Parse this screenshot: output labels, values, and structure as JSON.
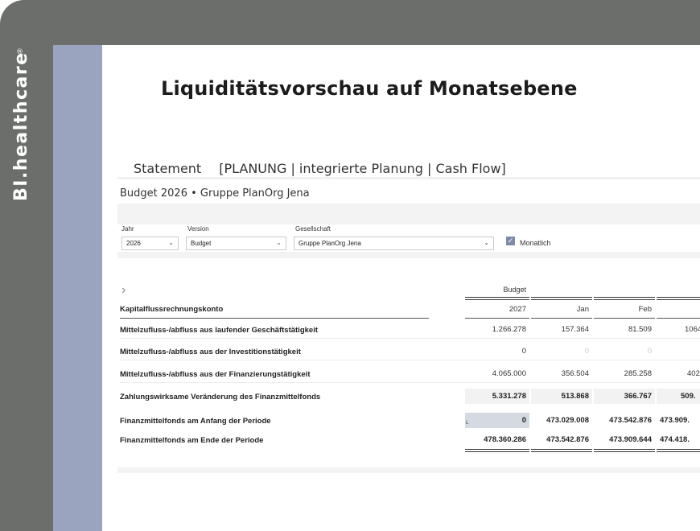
{
  "brand": {
    "name": "BI.healthcare",
    "registered": "®"
  },
  "headline": "Liquiditätsvorschau auf Monatsebene",
  "statement": {
    "prefix": "Statement",
    "title": "[PLANUNG | integrierte Planung | Cash Flow]"
  },
  "subtitle": "Budget 2026 • Gruppe PlanOrg Jena",
  "filters": {
    "jahr": {
      "label": "Jahr",
      "value": "2026"
    },
    "version": {
      "label": "Version",
      "value": "Budget"
    },
    "gesellschaft": {
      "label": "Gesellschaft",
      "value": "Gruppe PlanOrg Jena"
    },
    "monatlich": {
      "label": "Monatlich",
      "checked": true
    }
  },
  "table": {
    "row_header": "Kapitalflussrechnungskonto",
    "group_header": "Budget",
    "columns": [
      "2027",
      "Jan",
      "Feb",
      ""
    ],
    "rows": [
      {
        "label": "Mittelzufluss-/abfluss aus laufender Geschäftstätigkeit",
        "values": [
          "1.266.278",
          "157.364",
          "81.509",
          "1064"
        ],
        "style": "normal"
      },
      {
        "label": "Mittelzufluss-/abfluss aus der Investitionstätigkeit",
        "values": [
          "0",
          "0",
          "0",
          ""
        ],
        "style": "normal"
      },
      {
        "label": "Mittelzufluss-/abfluss aus der Finanzierungstätigkeit",
        "values": [
          "4.065.000",
          "356.504",
          "285.258",
          "402"
        ],
        "style": "normal"
      },
      {
        "label": "Zahlungswirksame Veränderung des Finanzmittelfonds",
        "values": [
          "5.331.278",
          "513.868",
          "366.767",
          "509."
        ],
        "style": "total"
      },
      {
        "label": "Finanzmittelfonds am Anfang der Periode",
        "values": [
          "0",
          "473.029.008",
          "473.542.876",
          "473.909."
        ],
        "style": "bold"
      },
      {
        "label": "Finanzmittelfonds am Ende der Periode",
        "values": [
          "478.360.286",
          "473.542.876",
          "473.909.644",
          "474.418."
        ],
        "style": "final"
      }
    ]
  },
  "icons": {
    "expander": "chevron-right-icon",
    "dropdown": "chevron-down-icon",
    "check": "checkmark-icon"
  },
  "colors": {
    "frame": "#6b6e6a",
    "accent_strip": "#9aa4bf",
    "checkbox": "#7d8aa8"
  }
}
